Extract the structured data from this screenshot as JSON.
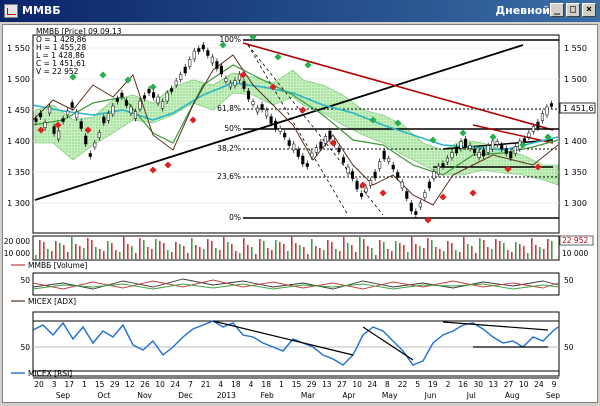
{
  "window": {
    "title": "ММВБ",
    "mode": "Дневной",
    "buttons": {
      "minimize": "_",
      "maximize": "□",
      "close": "×"
    }
  },
  "main_panel": {
    "legend_title": "ММВБ [Price] 09.09.13",
    "open": "O = 1 428,86",
    "high": "H = 1 455,28",
    "low": "L = 1 428,86",
    "close": "C = 1 451,61",
    "volume": "V = 22 952",
    "last_price_tag": "1 451,6",
    "y_ticks": [
      "1 550",
      "1 500",
      "1 450",
      "1 400",
      "1 350",
      "1 300"
    ],
    "fib_levels": [
      "100%",
      "61,8%",
      "50%",
      "38,2%",
      "23,6%",
      "0%"
    ]
  },
  "volume_panel": {
    "label": "ММВБ [Volume]",
    "left_ticks": [
      "20 000",
      "10 000"
    ],
    "right_ticks": [
      "22 952",
      "10 000"
    ]
  },
  "adx_panel": {
    "label": "MICEX [ADX]",
    "left_tick": "50",
    "right_tick": "50"
  },
  "rsi_panel": {
    "label": "MICEX [RSI]",
    "left_tick": "50",
    "right_tick": "50"
  },
  "x_axis": {
    "days": [
      "20",
      "3",
      "17",
      "1",
      "15",
      "29",
      "12",
      "26",
      "10",
      "24",
      "7",
      "21",
      "4",
      "18",
      "4",
      "18",
      "1",
      "15",
      "29",
      "13",
      "27",
      "10",
      "24",
      "8",
      "22",
      "5",
      "19",
      "2",
      "16",
      "30",
      "13",
      "27",
      "10",
      "24",
      "9"
    ],
    "months": [
      "Sep",
      "Oct",
      "Nov",
      "Dec",
      "2013",
      "Feb",
      "Mar",
      "Apr",
      "May",
      "Jun",
      "Jul",
      "Aug",
      "Sep"
    ]
  },
  "colors": {
    "title_start": "#0a246a",
    "title_end": "#3a6ea5",
    "up_candle": "#ffffff",
    "down_candle": "#000000",
    "trend_red": "#b00000",
    "ma_teal": "#2ab5c8",
    "ma_green": "#3a9a3a",
    "rsi_blue": "#1e6fd0",
    "vol_red": "#c04040",
    "vol_green": "#40a040",
    "signal_up": "#22b14c",
    "signal_down": "#e02020",
    "cloud": "#a8e4a0"
  }
}
